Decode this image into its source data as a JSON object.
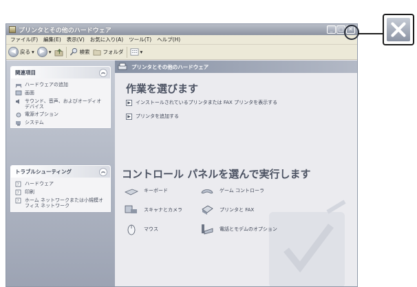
{
  "window": {
    "title": "プリンタとその他のハードウェア",
    "controls": {
      "minimize": "_",
      "maximize": "□",
      "close": "✕"
    }
  },
  "menubar": [
    "ファイル(F)",
    "編集(E)",
    "表示(V)",
    "お気に入り(A)",
    "ツール(T)",
    "ヘルプ(H)"
  ],
  "toolbar": {
    "back": "戻る",
    "search": "検索",
    "folders": "フォルダ"
  },
  "left": {
    "related": {
      "header": "関連項目",
      "items": [
        "ハードウェアの追加",
        "画面",
        "サウンド、音声、およびオーディオ デバイス",
        "電源オプション",
        "システム"
      ]
    },
    "troubleshoot": {
      "header": "トラブルシューティング",
      "items": [
        "ハードウェア",
        "印刷",
        "ホーム ネットワークまたは小規模オフィス ネットワーク"
      ]
    }
  },
  "right": {
    "header": "プリンタとその他のハードウェア",
    "task_heading": "作業を選びます",
    "tasks": [
      "インストールされているプリンタまたは FAX プリンタを表示する",
      "プリンタを追加する"
    ],
    "cp_heading": "コントロール パネルを選んで実行します",
    "categories": [
      "キーボード",
      "ゲーム コントローラ",
      "スキャナとカメラ",
      "プリンタと FAX",
      "マウス",
      "電話とモデムのオプション"
    ]
  }
}
